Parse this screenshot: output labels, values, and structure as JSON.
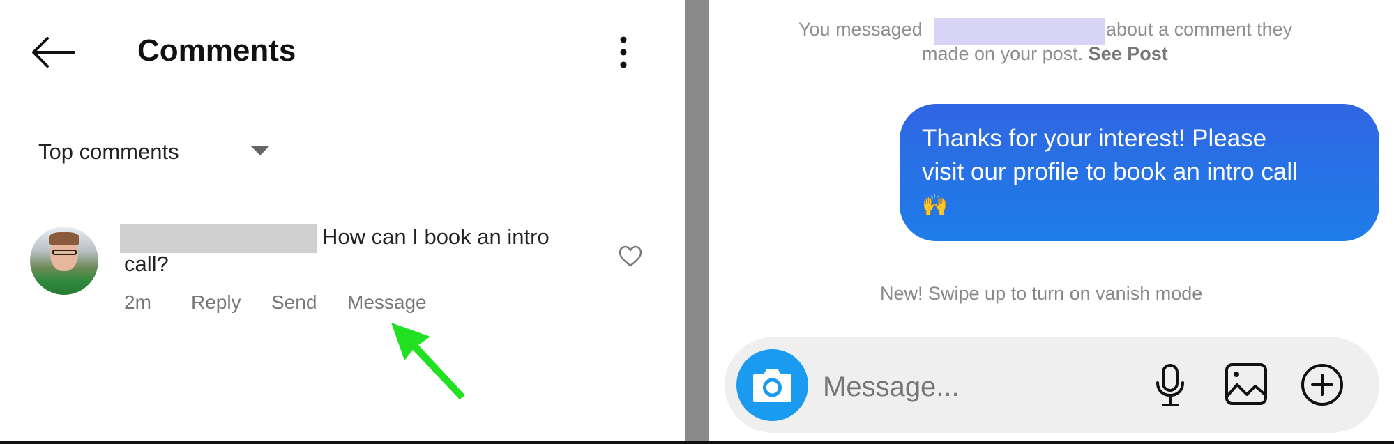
{
  "comments_screen": {
    "title": "Comments",
    "sort_label": "Top comments",
    "comment": {
      "text_line1": "How can I book an intro",
      "text_line2": "call?",
      "time": "2m",
      "actions": [
        "Reply",
        "Send",
        "Message"
      ]
    },
    "icons": [
      "back-arrow-icon",
      "more-vertical-icon",
      "chevron-down-icon",
      "heart-icon"
    ],
    "annotation_arrow_color": "#22e022"
  },
  "dm_screen": {
    "system_line1_before": "You messaged",
    "system_line1_after": "about a comment they",
    "system_line2": "made on your post.",
    "see_post": "See Post",
    "message_line1": "Thanks for your interest! Please",
    "message_line2": "visit our profile to book an intro call",
    "message_emoji": "🙌",
    "vanish_hint": "New! Swipe up to turn on vanish mode",
    "input_placeholder": "Message...",
    "bubble_color": "#2a6fe5",
    "camera_color": "#1a9bf0",
    "icons": [
      "camera-icon",
      "microphone-icon",
      "gallery-icon",
      "add-circle-icon"
    ]
  }
}
